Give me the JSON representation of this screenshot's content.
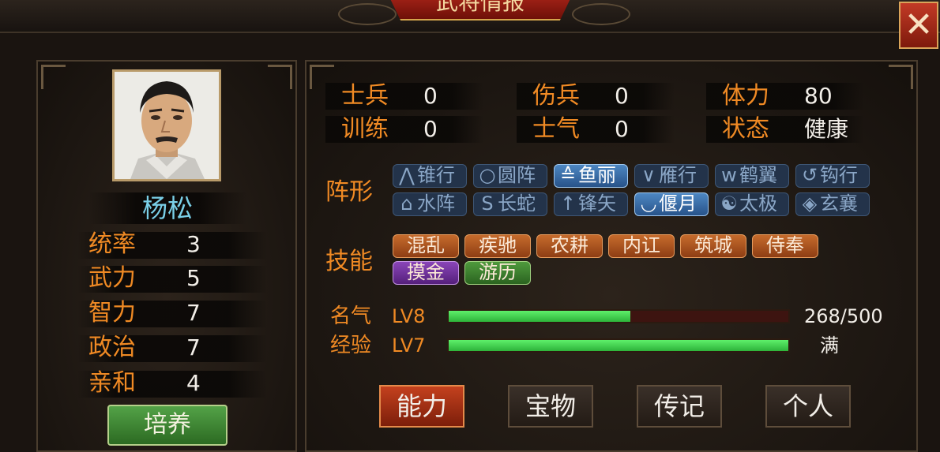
{
  "window": {
    "title": "武将情报",
    "close_label": "✕"
  },
  "general": {
    "name": "杨松",
    "stats": [
      {
        "label": "统率",
        "value": "3"
      },
      {
        "label": "武力",
        "value": "5"
      },
      {
        "label": "智力",
        "value": "7"
      },
      {
        "label": "政治",
        "value": "7"
      },
      {
        "label": "亲和",
        "value": "4"
      }
    ],
    "train_label": "培养"
  },
  "troops": [
    {
      "label": "士兵",
      "value": "0"
    },
    {
      "label": "伤兵",
      "value": "0"
    },
    {
      "label": "体力",
      "value": "80"
    },
    {
      "label": "训练",
      "value": "0"
    },
    {
      "label": "士气",
      "value": "0"
    },
    {
      "label": "状态",
      "value": "健康"
    }
  ],
  "formation": {
    "label": "阵形",
    "items": [
      {
        "label": "锥行",
        "icon": "arrow-up-icon",
        "glyph": "⋀",
        "active": false
      },
      {
        "label": "圆阵",
        "icon": "circle-icon",
        "glyph": "○",
        "active": false
      },
      {
        "label": "鱼丽",
        "icon": "chevrons-up-icon",
        "glyph": "≙",
        "active": true
      },
      {
        "label": "雁行",
        "icon": "v-shape-icon",
        "glyph": "∨",
        "active": false
      },
      {
        "label": "鹤翼",
        "icon": "wings-icon",
        "glyph": "w",
        "active": false
      },
      {
        "label": "钩行",
        "icon": "hook-icon",
        "glyph": "↺",
        "active": false
      },
      {
        "label": "水阵",
        "icon": "house-icon",
        "glyph": "⌂",
        "active": false
      },
      {
        "label": "长蛇",
        "icon": "snake-icon",
        "glyph": "S",
        "active": false
      },
      {
        "label": "锋矢",
        "icon": "arrow-icon",
        "glyph": "↑",
        "active": false
      },
      {
        "label": "偃月",
        "icon": "crescent-icon",
        "glyph": "◡",
        "active": true
      },
      {
        "label": "太极",
        "icon": "taiji-icon",
        "glyph": "☯",
        "active": false
      },
      {
        "label": "玄襄",
        "icon": "diamond-icon",
        "glyph": "◈",
        "active": false
      }
    ]
  },
  "skills": {
    "label": "技能",
    "items": [
      {
        "label": "混乱",
        "color": "orange"
      },
      {
        "label": "疾驰",
        "color": "orange"
      },
      {
        "label": "农耕",
        "color": "orange"
      },
      {
        "label": "内讧",
        "color": "orange"
      },
      {
        "label": "筑城",
        "color": "orange"
      },
      {
        "label": "侍奉",
        "color": "orange"
      },
      {
        "label": "摸金",
        "color": "purple"
      },
      {
        "label": "游历",
        "color": "green"
      }
    ]
  },
  "fame": {
    "label": "名气",
    "level": "LV8",
    "current": 268,
    "max": 500,
    "text": "268/500"
  },
  "experience": {
    "label": "经验",
    "level": "LV7",
    "fraction": 1.0,
    "text": "满"
  },
  "tabs": [
    {
      "label": "能力",
      "active": true
    },
    {
      "label": "宝物",
      "active": false
    },
    {
      "label": "传记",
      "active": false
    },
    {
      "label": "个人",
      "active": false
    }
  ],
  "colors": {
    "accent_orange": "#f08a24",
    "name_cyan": "#7ad0e8",
    "bar_green": "#3fd34c"
  }
}
